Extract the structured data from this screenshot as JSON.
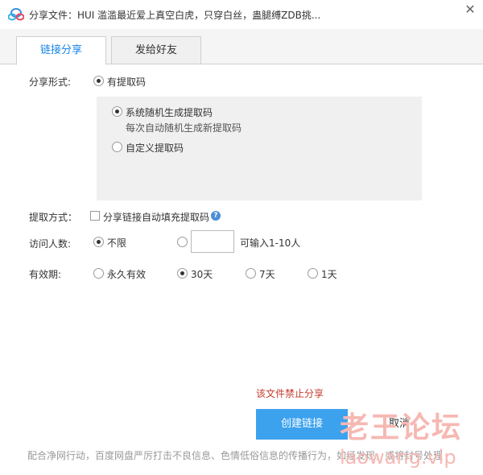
{
  "window": {
    "title": "分享文件：HUI 滥滥最近爱上真空白虎，只穿白丝，蛊腿缚ZDB挑...",
    "close_glyph": "✕"
  },
  "tabs": [
    {
      "label": "链接分享",
      "active": true
    },
    {
      "label": "发给好友",
      "active": false
    }
  ],
  "share_form": {
    "label": "分享形式:",
    "option_label": "有提取码",
    "selected": true
  },
  "code_options": {
    "random": {
      "label": "系统随机生成提取码",
      "hint": "每次自动随机生成新提取码",
      "selected": true
    },
    "custom": {
      "label": "自定义提取码",
      "selected": false
    }
  },
  "extract_method": {
    "label": "提取方式：",
    "checkbox_label": "分享链接自动填充提取码",
    "checked": false,
    "help_glyph": "?"
  },
  "visitors": {
    "label": "访问人数:",
    "unlimited_label": "不限",
    "unlimited_selected": true,
    "custom_selected": false,
    "input_value": "",
    "input_hint": "可输入1-10人"
  },
  "validity": {
    "label": "有效期:",
    "options": [
      {
        "label": "永久有效",
        "selected": false
      },
      {
        "label": "30天",
        "selected": true
      },
      {
        "label": "7天",
        "selected": false
      },
      {
        "label": "1天",
        "selected": false
      }
    ]
  },
  "warning": "该文件禁止分享",
  "buttons": {
    "create": "创建链接",
    "cancel": "取消"
  },
  "footer_note": "配合净网行动，百度网盘严厉打击不良信息、色情低俗信息的传播行为，如经发现，或将封号处理",
  "watermark": {
    "cn": "老王论坛",
    "url": "laowang.vip"
  },
  "colors": {
    "accent": "#3ca2ee",
    "tab_active_text": "#1a86e8",
    "warning": "#c33a2d"
  }
}
